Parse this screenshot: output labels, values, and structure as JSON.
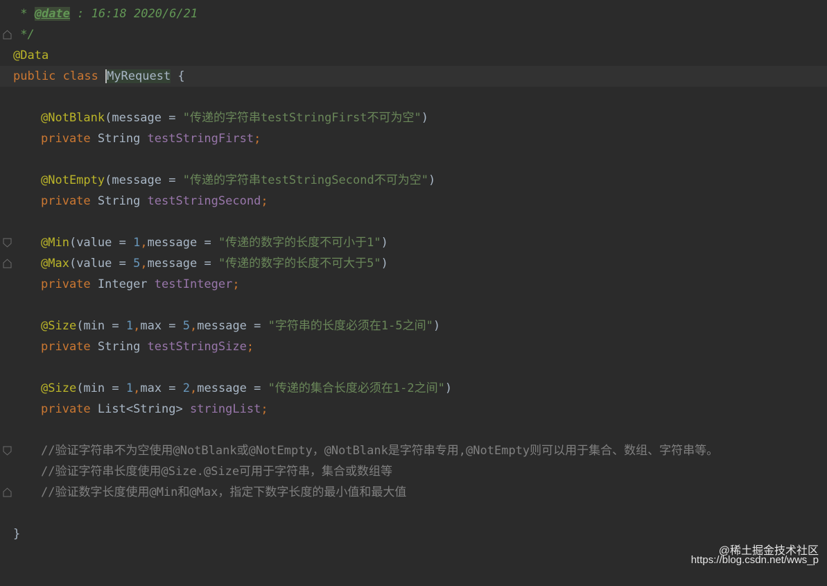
{
  "editor": {
    "doc_date_prefix": " * ",
    "doc_date_tag": "@date",
    "doc_date_value": " : 16:18 2020/6/21",
    "doc_end": " */",
    "annotation_data": "@Data",
    "class_kw": "public class ",
    "class_name": "MyRequest",
    "class_open": " {",
    "f1_annot": "@NotBlank",
    "f1_args_open": "(message = ",
    "f1_message": "\"传递的字符串testStringFirst不可为空\"",
    "f1_args_close": ")",
    "f1_private": "private ",
    "f1_type": "String ",
    "f1_name": "testStringFirst",
    "f2_annot": "@NotEmpty",
    "f2_args_open": "(message = ",
    "f2_message": "\"传递的字符串testStringSecond不可为空\"",
    "f2_args_close": ")",
    "f2_private": "private ",
    "f2_type": "String ",
    "f2_name": "testStringSecond",
    "f3_annot_min": "@Min",
    "f3_min_open": "(value = ",
    "f3_min_value": "1",
    "f3_min_mid": "message = ",
    "f3_min_message": "\"传递的数字的长度不可小于1\"",
    "f3_annot_max": "@Max",
    "f3_max_open": "(value = ",
    "f3_max_value": "5",
    "f3_max_mid": "message = ",
    "f3_max_message": "\"传递的数字的长度不可大于5\"",
    "f3_private": "private ",
    "f3_type": "Integer ",
    "f3_name": "testInteger",
    "f4_annot": "@Size",
    "f4_open": "(min = ",
    "f4_min": "1",
    "f4_max_label": "max = ",
    "f4_max": "5",
    "f4_msg_label": "message = ",
    "f4_message": "\"字符串的长度必须在1-5之间\"",
    "f4_private": "private ",
    "f4_type": "String ",
    "f4_name": "testStringSize",
    "f5_annot": "@Size",
    "f5_open": "(min = ",
    "f5_min": "1",
    "f5_max_label": "max = ",
    "f5_max": "2",
    "f5_msg_label": "message = ",
    "f5_message": "\"传递的集合长度必须在1-2之间\"",
    "f5_private": "private ",
    "f5_type": "List<String> ",
    "f5_name": "stringList",
    "comment1": "//验证字符串不为空使用@NotBlank或@NotEmpty，@NotBlank是字符串专用,@NotEmpty则可以用于集合、数组、字符串等。",
    "comment2": "//验证字符串长度使用@Size.@Size可用于字符串，集合或数组等",
    "comment3": "//验证数字长度使用@Min和@Max，指定下数字长度的最小值和最大值",
    "class_close": "}",
    "comma": ",",
    "semicolon": ";",
    "close_paren": ")"
  },
  "watermark": {
    "line1": "@稀土掘金技术社区",
    "line2": "https://blog.csdn.net/wws_p"
  },
  "colors": {
    "background": "#2b2b2b",
    "keyword": "#cc7832",
    "annotation": "#bbb529",
    "string": "#6a8759",
    "number": "#6897bb",
    "field": "#9876aa",
    "comment": "#808080",
    "doc_comment": "#629755"
  }
}
